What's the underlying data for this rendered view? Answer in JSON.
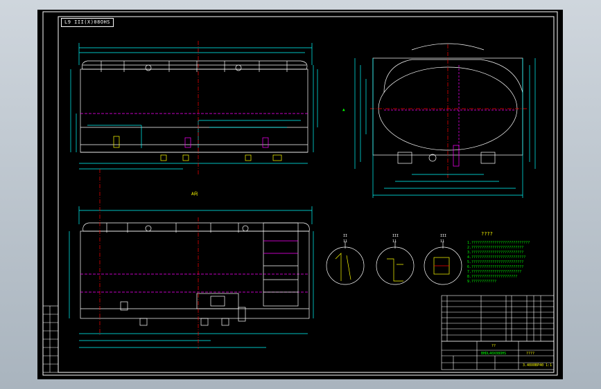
{
  "drawing": {
    "title_tag": "L9 III(X)08OHS",
    "section_marks": [
      {
        "top": "II",
        "bottom": "11"
      },
      {
        "top": "III",
        "bottom": "11"
      },
      {
        "top": "III",
        "bottom": "11"
      }
    ],
    "notes_title": "????",
    "notes": [
      "1.????????????????????????????",
      "2.?????????????????????????",
      "3.?????????????????????????",
      "4.??????????????????????????",
      "5.?????????????????????????",
      "6.?????????????????????????",
      "7.????????????????????????",
      "8.??????????????????????",
      "9.????????????"
    ],
    "title_block": {
      "drawing_no": "??",
      "name": "????",
      "part_label": "3.40X0BP40 1:1",
      "material": "BHDL40X08OHS"
    },
    "colors": {
      "background": "#000000",
      "frame": "#ffffff",
      "outline": "#ffffff",
      "dimension": "#00ffff",
      "centerline": "#ff0000",
      "hidden": "#ff00ff",
      "text": "#ffff00",
      "annotation": "#00ff00"
    }
  }
}
